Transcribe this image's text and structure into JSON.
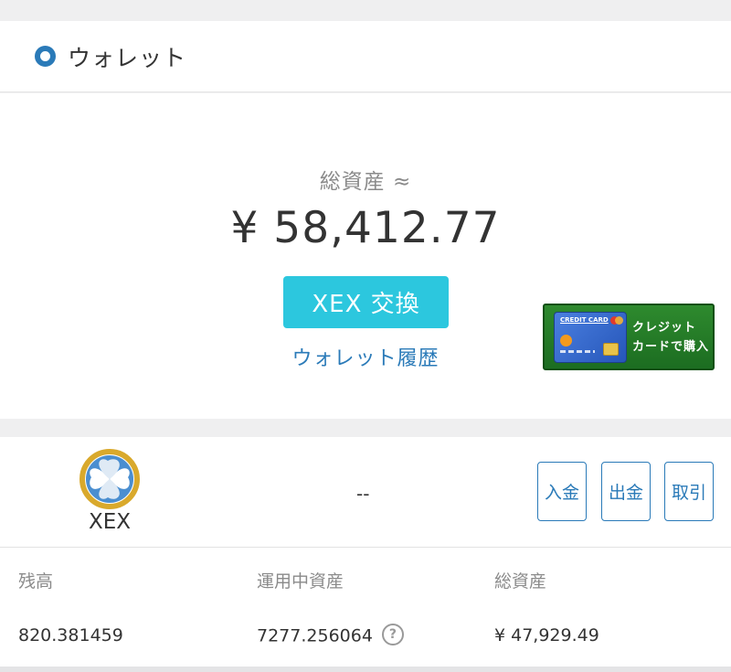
{
  "header": {
    "title": "ウォレット",
    "icon": "ring-icon",
    "icon_color": "#2a7ab8"
  },
  "summary": {
    "total_label": "総資産 ≈",
    "total_value": "¥ 58,412.77",
    "exchange_label": "XEX 交換",
    "history_label": "ウォレット履歴",
    "accent_color": "#2cc7de"
  },
  "banner": {
    "card_title": "CREDIT CARD",
    "line1": "クレジット",
    "line2": "カードで購入",
    "color": "#2e8a2e"
  },
  "asset": {
    "coin_name": "XEX",
    "coin_status": "--",
    "buttons": {
      "deposit": "入金",
      "withdraw": "出金",
      "trade": "取引"
    },
    "columns": {
      "balance_label": "残高",
      "operating_label": "運用中資産",
      "total_label": "総資産"
    },
    "values": {
      "balance": "820.381459",
      "operating": "7277.256064",
      "total": "¥ 47,929.49"
    },
    "help_icon": "?"
  }
}
